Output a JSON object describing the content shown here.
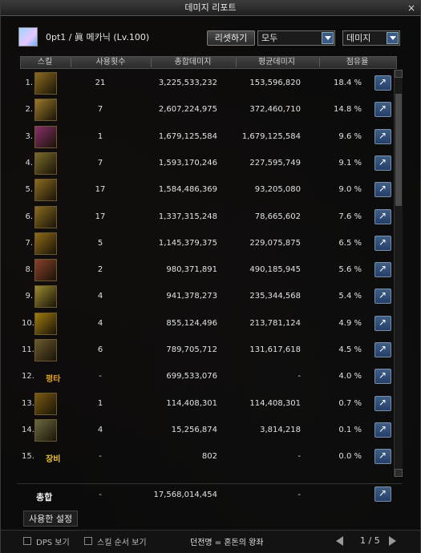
{
  "window": {
    "title": "데미지 리포트",
    "close": "×"
  },
  "header": {
    "player": "0pt1 / 眞 메카닉 (Lv.100)",
    "reset_label": "리셋하기",
    "filter_value": "모두",
    "metric_value": "데미지"
  },
  "columns": {
    "skill": "스킬",
    "count": "사용횟수",
    "total": "총합데미지",
    "avg": "평균데미지",
    "share": "점유율"
  },
  "colors": {
    "icon_border": "#6b5a30",
    "share_button": "#3f5f86"
  },
  "rows": [
    {
      "rank": "1.",
      "count": "21",
      "total": "3,225,533,232",
      "avg": "153,596,820",
      "share": "18.4 %",
      "icon": "skill-icon",
      "color": "#8a6a1e"
    },
    {
      "rank": "2.",
      "count": "7",
      "total": "2,607,224,975",
      "avg": "372,460,710",
      "share": "14.8 %",
      "icon": "skill-icon",
      "color": "#9a7a2a"
    },
    {
      "rank": "3.",
      "count": "1",
      "total": "1,679,125,584",
      "avg": "1,679,125,584",
      "share": "9.6 %",
      "icon": "skill-icon",
      "color": "#8a2f6a"
    },
    {
      "rank": "4.",
      "count": "7",
      "total": "1,593,170,246",
      "avg": "227,595,749",
      "share": "9.1 %",
      "icon": "skill-icon",
      "color": "#7a6a2a"
    },
    {
      "rank": "5.",
      "count": "17",
      "total": "1,584,486,369",
      "avg": "93,205,080",
      "share": "9.0 %",
      "icon": "skill-icon",
      "color": "#8a6a20"
    },
    {
      "rank": "6.",
      "count": "17",
      "total": "1,337,315,248",
      "avg": "78,665,602",
      "share": "7.6 %",
      "icon": "skill-icon",
      "color": "#8a6a20"
    },
    {
      "rank": "7.",
      "count": "5",
      "total": "1,145,379,375",
      "avg": "229,075,875",
      "share": "6.5 %",
      "icon": "skill-icon",
      "color": "#8f6a18"
    },
    {
      "rank": "8.",
      "count": "2",
      "total": "980,371,891",
      "avg": "490,185,945",
      "share": "5.6 %",
      "icon": "skill-icon",
      "color": "#8a3f2a"
    },
    {
      "rank": "9.",
      "count": "4",
      "total": "941,378,273",
      "avg": "235,344,568",
      "share": "5.4 %",
      "icon": "skill-icon",
      "color": "#9a8a30"
    },
    {
      "rank": "10.",
      "count": "4",
      "total": "855,124,496",
      "avg": "213,781,124",
      "share": "4.9 %",
      "icon": "skill-icon",
      "color": "#a07a10"
    },
    {
      "rank": "11.",
      "count": "6",
      "total": "789,705,712",
      "avg": "131,617,618",
      "share": "4.5 %",
      "icon": "skill-icon",
      "color": "#6a5a30"
    },
    {
      "rank": "12.",
      "label": "평타",
      "label_color": "#e0a020",
      "count": "-",
      "total": "699,533,076",
      "avg": "-",
      "share": "4.0 %"
    },
    {
      "rank": "13.",
      "count": "1",
      "total": "114,408,301",
      "avg": "114,408,301",
      "share": "0.7 %",
      "icon": "skill-icon",
      "color": "#7a5a10"
    },
    {
      "rank": "14.",
      "count": "4",
      "total": "15,256,874",
      "avg": "3,814,218",
      "share": "0.1 %",
      "icon": "skill-icon",
      "color": "#6a6a40"
    },
    {
      "rank": "15.",
      "label": "장비",
      "label_color": "#f2c230",
      "count": "-",
      "total": "802",
      "avg": "-",
      "share": "0.0 %"
    }
  ],
  "summary": {
    "label": "총합",
    "count": "-",
    "total": "17,568,014,454",
    "avg": "-"
  },
  "used_settings": "사용한 설정",
  "footer": {
    "dps_label": "DPS 보기",
    "order_label": "스킬 순서 보기",
    "dungeon": "던전명 = 혼돈의 왕좌",
    "page": "1 / 5"
  }
}
